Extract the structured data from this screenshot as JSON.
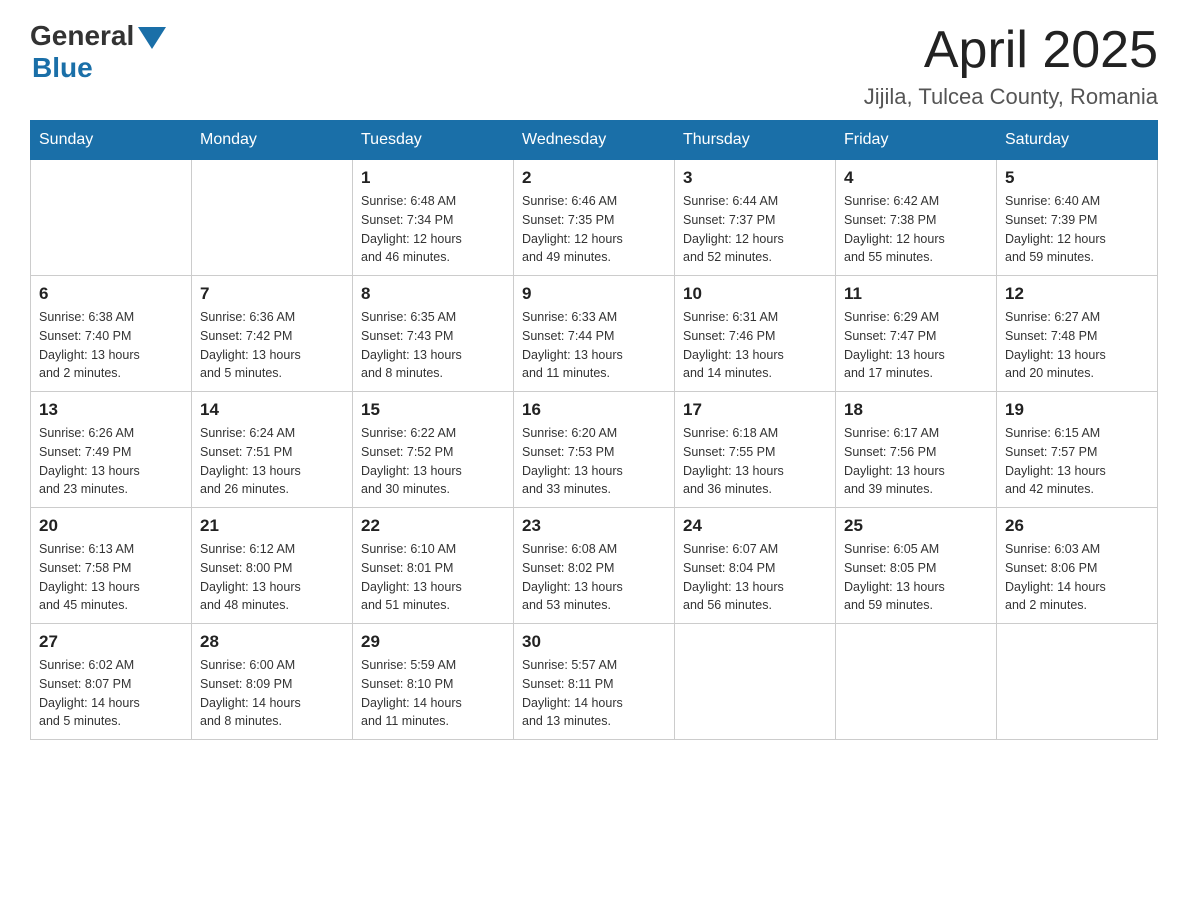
{
  "header": {
    "logo_general": "General",
    "logo_blue": "Blue",
    "month_title": "April 2025",
    "location": "Jijila, Tulcea County, Romania"
  },
  "weekdays": [
    "Sunday",
    "Monday",
    "Tuesday",
    "Wednesday",
    "Thursday",
    "Friday",
    "Saturday"
  ],
  "weeks": [
    [
      {
        "day": "",
        "info": ""
      },
      {
        "day": "",
        "info": ""
      },
      {
        "day": "1",
        "info": "Sunrise: 6:48 AM\nSunset: 7:34 PM\nDaylight: 12 hours\nand 46 minutes."
      },
      {
        "day": "2",
        "info": "Sunrise: 6:46 AM\nSunset: 7:35 PM\nDaylight: 12 hours\nand 49 minutes."
      },
      {
        "day": "3",
        "info": "Sunrise: 6:44 AM\nSunset: 7:37 PM\nDaylight: 12 hours\nand 52 minutes."
      },
      {
        "day": "4",
        "info": "Sunrise: 6:42 AM\nSunset: 7:38 PM\nDaylight: 12 hours\nand 55 minutes."
      },
      {
        "day": "5",
        "info": "Sunrise: 6:40 AM\nSunset: 7:39 PM\nDaylight: 12 hours\nand 59 minutes."
      }
    ],
    [
      {
        "day": "6",
        "info": "Sunrise: 6:38 AM\nSunset: 7:40 PM\nDaylight: 13 hours\nand 2 minutes."
      },
      {
        "day": "7",
        "info": "Sunrise: 6:36 AM\nSunset: 7:42 PM\nDaylight: 13 hours\nand 5 minutes."
      },
      {
        "day": "8",
        "info": "Sunrise: 6:35 AM\nSunset: 7:43 PM\nDaylight: 13 hours\nand 8 minutes."
      },
      {
        "day": "9",
        "info": "Sunrise: 6:33 AM\nSunset: 7:44 PM\nDaylight: 13 hours\nand 11 minutes."
      },
      {
        "day": "10",
        "info": "Sunrise: 6:31 AM\nSunset: 7:46 PM\nDaylight: 13 hours\nand 14 minutes."
      },
      {
        "day": "11",
        "info": "Sunrise: 6:29 AM\nSunset: 7:47 PM\nDaylight: 13 hours\nand 17 minutes."
      },
      {
        "day": "12",
        "info": "Sunrise: 6:27 AM\nSunset: 7:48 PM\nDaylight: 13 hours\nand 20 minutes."
      }
    ],
    [
      {
        "day": "13",
        "info": "Sunrise: 6:26 AM\nSunset: 7:49 PM\nDaylight: 13 hours\nand 23 minutes."
      },
      {
        "day": "14",
        "info": "Sunrise: 6:24 AM\nSunset: 7:51 PM\nDaylight: 13 hours\nand 26 minutes."
      },
      {
        "day": "15",
        "info": "Sunrise: 6:22 AM\nSunset: 7:52 PM\nDaylight: 13 hours\nand 30 minutes."
      },
      {
        "day": "16",
        "info": "Sunrise: 6:20 AM\nSunset: 7:53 PM\nDaylight: 13 hours\nand 33 minutes."
      },
      {
        "day": "17",
        "info": "Sunrise: 6:18 AM\nSunset: 7:55 PM\nDaylight: 13 hours\nand 36 minutes."
      },
      {
        "day": "18",
        "info": "Sunrise: 6:17 AM\nSunset: 7:56 PM\nDaylight: 13 hours\nand 39 minutes."
      },
      {
        "day": "19",
        "info": "Sunrise: 6:15 AM\nSunset: 7:57 PM\nDaylight: 13 hours\nand 42 minutes."
      }
    ],
    [
      {
        "day": "20",
        "info": "Sunrise: 6:13 AM\nSunset: 7:58 PM\nDaylight: 13 hours\nand 45 minutes."
      },
      {
        "day": "21",
        "info": "Sunrise: 6:12 AM\nSunset: 8:00 PM\nDaylight: 13 hours\nand 48 minutes."
      },
      {
        "day": "22",
        "info": "Sunrise: 6:10 AM\nSunset: 8:01 PM\nDaylight: 13 hours\nand 51 minutes."
      },
      {
        "day": "23",
        "info": "Sunrise: 6:08 AM\nSunset: 8:02 PM\nDaylight: 13 hours\nand 53 minutes."
      },
      {
        "day": "24",
        "info": "Sunrise: 6:07 AM\nSunset: 8:04 PM\nDaylight: 13 hours\nand 56 minutes."
      },
      {
        "day": "25",
        "info": "Sunrise: 6:05 AM\nSunset: 8:05 PM\nDaylight: 13 hours\nand 59 minutes."
      },
      {
        "day": "26",
        "info": "Sunrise: 6:03 AM\nSunset: 8:06 PM\nDaylight: 14 hours\nand 2 minutes."
      }
    ],
    [
      {
        "day": "27",
        "info": "Sunrise: 6:02 AM\nSunset: 8:07 PM\nDaylight: 14 hours\nand 5 minutes."
      },
      {
        "day": "28",
        "info": "Sunrise: 6:00 AM\nSunset: 8:09 PM\nDaylight: 14 hours\nand 8 minutes."
      },
      {
        "day": "29",
        "info": "Sunrise: 5:59 AM\nSunset: 8:10 PM\nDaylight: 14 hours\nand 11 minutes."
      },
      {
        "day": "30",
        "info": "Sunrise: 5:57 AM\nSunset: 8:11 PM\nDaylight: 14 hours\nand 13 minutes."
      },
      {
        "day": "",
        "info": ""
      },
      {
        "day": "",
        "info": ""
      },
      {
        "day": "",
        "info": ""
      }
    ]
  ]
}
